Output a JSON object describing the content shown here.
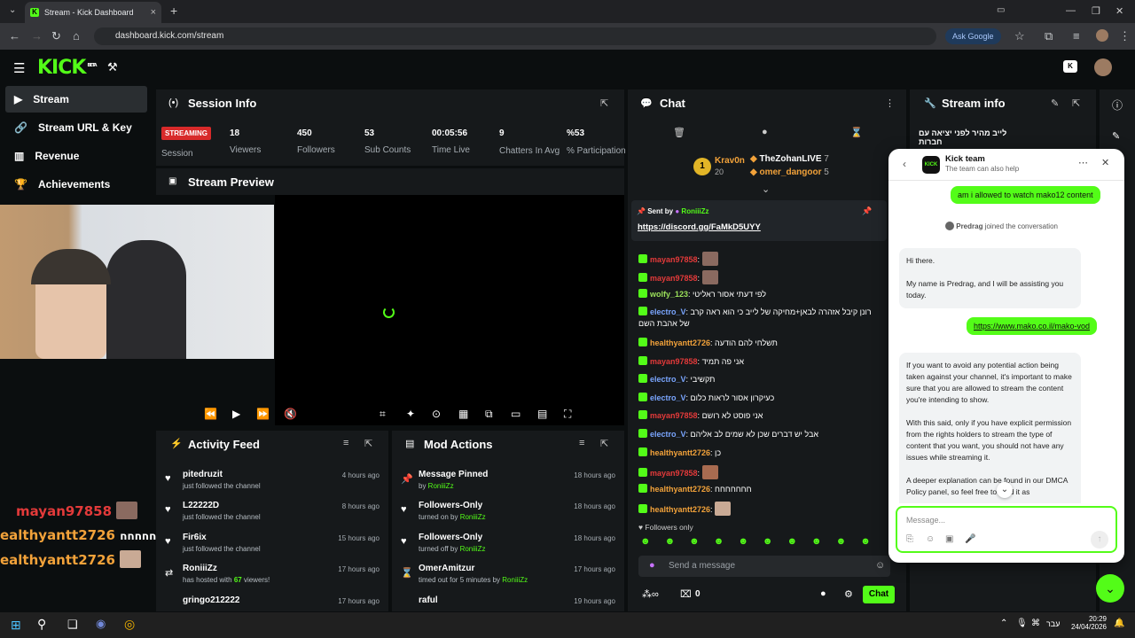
{
  "browser": {
    "tab_title": "Stream - Kick Dashboard",
    "url": "dashboard.kick.com/stream",
    "ask_google": "Ask Google"
  },
  "app": {
    "logo": "KICK",
    "logo_badge": "BETA"
  },
  "sidebar": {
    "items": [
      {
        "label": "Stream",
        "icon": "broadcast-icon"
      },
      {
        "label": "Stream URL & Key",
        "icon": "link-icon"
      },
      {
        "label": "Revenue",
        "icon": "chart-icon"
      },
      {
        "label": "Achievements",
        "icon": "trophy-icon"
      }
    ]
  },
  "session_info": {
    "title": "Session Info",
    "status": "STREAMING",
    "status_label": "Session",
    "stats": [
      {
        "value": "18",
        "label": "Viewers"
      },
      {
        "value": "450",
        "label": "Followers"
      },
      {
        "value": "53",
        "label": "Sub Counts"
      },
      {
        "value": "00:05:56",
        "label": "Time Live"
      },
      {
        "value": "9",
        "label": "Chatters In Avg"
      },
      {
        "value": "%53",
        "label": "% Participation"
      }
    ]
  },
  "stream_preview": {
    "title": "Stream Preview"
  },
  "activity_feed": {
    "title": "Activity Feed",
    "items": [
      {
        "name": "pitedruzit",
        "sub": "just followed the channel",
        "ago": "4 hours ago"
      },
      {
        "name": "L22222D",
        "sub": "just followed the channel",
        "ago": "8 hours ago"
      },
      {
        "name": "Fir6ix",
        "sub": "just followed the channel",
        "ago": "15 hours ago"
      },
      {
        "name": "RoniiiZz",
        "sub_pre": "has hosted with ",
        "sub_num": "67",
        "sub_post": " viewers!",
        "ago": "17 hours ago"
      },
      {
        "name": "gringo212222",
        "sub": "",
        "ago": "17 hours ago"
      }
    ]
  },
  "mod_actions": {
    "title": "Mod Actions",
    "items": [
      {
        "title": "Message Pinned",
        "sub_pre": "by ",
        "user": "RoniiiZz",
        "ago": "18 hours ago"
      },
      {
        "title": "Followers-Only",
        "sub_pre": "turned on by ",
        "user": "RoniiiZz",
        "ago": "18 hours ago"
      },
      {
        "title": "Followers-Only",
        "sub_pre": "turned off by ",
        "user": "RoniiiZz",
        "ago": "18 hours ago"
      },
      {
        "title": "OmerAmitzur",
        "sub_pre": "timed out for 5 minutes by ",
        "user": "RoniiiZz",
        "ago": "17 hours ago"
      },
      {
        "title": "raful",
        "sub_pre": "",
        "user": "",
        "ago": "19 hours ago"
      }
    ]
  },
  "chat": {
    "title": "Chat",
    "leaderboard": [
      {
        "name": "Krav0n",
        "count": "20"
      },
      {
        "name": "TheZohanLIVE",
        "count": "7"
      },
      {
        "name": "omer_dangoor",
        "count": "5"
      }
    ],
    "pinned": {
      "sent_by": "Sent by",
      "user": "RoniiiZz",
      "link": "https://discord.gg/FaMkD5UYY"
    },
    "messages": [
      {
        "user": "mayan97858",
        "text": "",
        "color": "red"
      },
      {
        "user": "mayan97858",
        "text": "",
        "color": "red"
      },
      {
        "user": "wolfy_123",
        "text": "לפי דעתי אסור ראליטי",
        "color": "grn"
      },
      {
        "user": "electro_V",
        "text": "רונן קיבל אזהרה לבאן+מחיקה של לייב כי הוא ראה קרב של אהבת השם",
        "color": "blu"
      },
      {
        "user": "healthyantt2726",
        "text": "תשלחי להם הודעה",
        "color": "org"
      },
      {
        "user": "mayan97858",
        "text": "אני פה תמיד",
        "color": "red"
      },
      {
        "user": "electro_V",
        "text": "תקשיבי",
        "color": "blu"
      },
      {
        "user": "electro_V",
        "text": "כעיקרון אסור לראות כלום",
        "color": "blu"
      },
      {
        "user": "mayan97858",
        "text": "אני פוסט לא רושם",
        "color": "red"
      },
      {
        "user": "electro_V",
        "text": "אבל יש דברים שכן לא שמים לב אליהם",
        "color": "blu"
      },
      {
        "user": "healthyantt2726",
        "text": "כן",
        "color": "org"
      },
      {
        "user": "mayan97858",
        "text": "",
        "color": "red"
      },
      {
        "user": "healthyantt2726",
        "text": "חחחחחחח",
        "color": "org"
      },
      {
        "user": "healthyantt2726",
        "text": "",
        "color": "org"
      }
    ],
    "followers_only": "Followers only",
    "input_placeholder": "Send a message",
    "count": "0",
    "send_label": "Chat"
  },
  "stream_info": {
    "title": "Stream info",
    "stream_title": "לייב מהיר לפני יציאה עם חברות"
  },
  "support": {
    "title": "Kick team",
    "subtitle": "The team can also help",
    "msg1": "am i allowed to watch mako12 content",
    "joined_name": "Predrag",
    "joined_text": " joined the conversation",
    "reply1_a": "Hi there.",
    "reply1_b": "My name is Predrag, and I will be assisting you today.",
    "msg2": "https://www.mako.co.il/mako-vod",
    "reply2_a": "If you want to avoid any potential action being taken against your channel, it's important to make sure that you are allowed to stream the content you're intending to show.",
    "reply2_b": "With this said, only if you have explicit permission from the rights holders to stream the type of content that you want, you should not have any issues while streaming it.",
    "reply2_c": "A deeper explanation can be found in our DMCA Policy panel, so feel free to read it as",
    "input_placeholder": "Message..."
  },
  "overlay": {
    "names": [
      {
        "name": "mayan97858",
        "text": ""
      },
      {
        "name": "ealthyantt2726",
        "text": "חחחחחחח"
      },
      {
        "name": "ealthyantt2726",
        "text": ""
      }
    ]
  },
  "taskbar": {
    "lang": "עבר",
    "time": "20:29",
    "date": "24/04/2026"
  },
  "colors": {
    "accent": "#53fc18",
    "live": "#d82a2a",
    "panel": "#16191b"
  }
}
